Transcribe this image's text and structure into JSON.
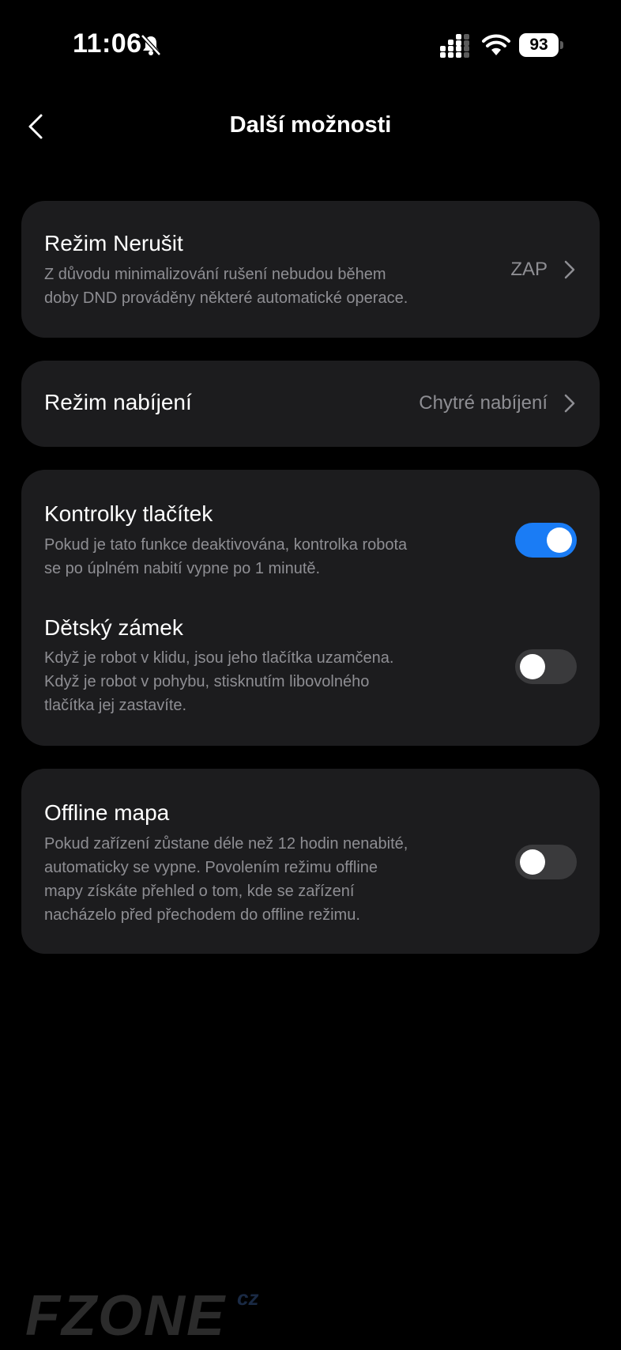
{
  "status_bar": {
    "time": "11:06",
    "bell_icon": "bell-slash-icon",
    "battery": "93"
  },
  "header": {
    "title": "Další možnosti",
    "back_icon": "chevron-left-icon"
  },
  "settings": {
    "dnd": {
      "title": "Režim Nerušit",
      "description_lines": [
        "Z důvodu minimalizování rušení nebudou během",
        "doby DND prováděny některé automatické operace."
      ],
      "value": "ZAP"
    },
    "charging": {
      "title": "Režim nabíjení",
      "value": "Chytré nabíjení"
    },
    "button_lights": {
      "title": "Kontrolky tlačítek",
      "description_lines": [
        "Pokud je tato funkce deaktivována, kontrolka robota",
        "se po úplném nabití vypne po 1 minutě."
      ],
      "enabled": true
    },
    "child_lock": {
      "title": "Dětský zámek",
      "description_lines": [
        "Když je robot v klidu, jsou jeho tlačítka uzamčena.",
        "Když je robot v pohybu, stisknutím libovolného",
        "tlačítka jej zastavíte."
      ],
      "enabled": false
    },
    "offline_map": {
      "title": "Offline mapa",
      "description_lines": [
        "Pokud zařízení zůstane déle než 12 hodin nenabité,",
        "automaticky se vypne. Povolením režimu offline",
        "mapy získáte přehled o tom, kde se zařízení",
        "nacházelo před přechodem do offline režimu."
      ],
      "enabled": false
    }
  },
  "watermark": {
    "text": "FZONE",
    "suffix": "cz"
  },
  "colors": {
    "background": "#000000",
    "card": "#1c1c1e",
    "secondary_text": "#8e8e93",
    "toggle_on": "#1a7cf5",
    "toggle_off": "#3a3a3c"
  }
}
